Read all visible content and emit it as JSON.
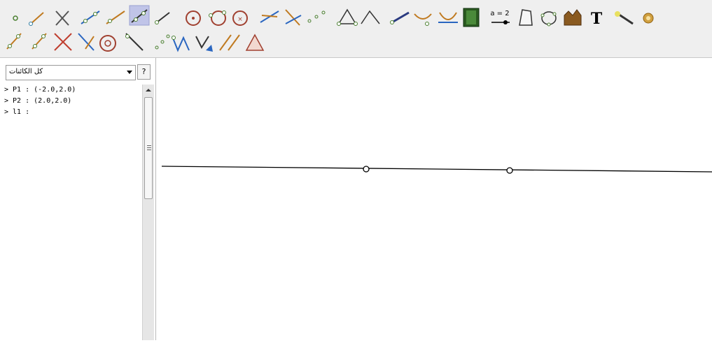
{
  "toolbar": {
    "row1": [
      "new-point-icon",
      "segment-icon",
      "intersect-icon",
      "line-through-points-icon",
      "ray-icon",
      "line-icon",
      "vector-icon",
      "circle-center-point-icon",
      "circle-three-points-icon",
      "circle-radius-icon",
      "perpendicular-line-icon",
      "angle-bisector-icon",
      "locus-icon",
      "polygon-icon",
      "angle-icon",
      "vector-from-point-icon",
      "curve-icon",
      "tangent-icon",
      "animation-icon",
      "slider-icon",
      "quad-icon",
      "conic-icon",
      "macro-icon",
      "text-icon",
      "move-graphics-icon",
      "gear-icon"
    ],
    "row2": [
      "midpoint-icon",
      "parallel-icon",
      "cross-icon",
      "reflect-icon",
      "circle-arc-icon",
      "mirror-line-icon",
      "dots-icon",
      "translate-icon",
      "vector-polygon-icon",
      "rotate-icon",
      "triangle-icon"
    ]
  },
  "left_panel": {
    "filter_label": "كل الكائنات",
    "help_label": "?",
    "objects": [
      {
        "text": "> P1 : (-2.0,2.0)"
      },
      {
        "text": "> P2 : (2.0,2.0)"
      },
      {
        "text": "> l1 :"
      }
    ]
  },
  "colors": {
    "toolbar_bg": "#efefef",
    "point_color": "#4a7f2f",
    "line_color": "#000000"
  }
}
